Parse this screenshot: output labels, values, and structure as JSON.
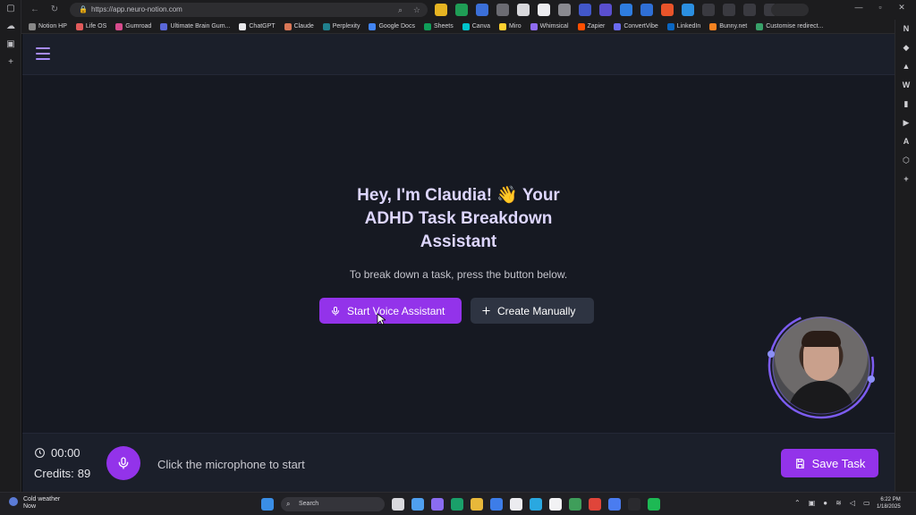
{
  "browser": {
    "url": "https://app.neuro-notion.com",
    "bookmarks": [
      "Notion HP",
      "Life OS",
      "Gumroad",
      "Ultimate Brain Gum...",
      "ChatGPT",
      "Claude",
      "Perplexity",
      "Google Docs",
      "Sheets",
      "Canva",
      "Miro",
      "Whimsical",
      "Zapier",
      "ConvertVibe",
      "LinkedIn",
      "Bunny.net",
      "Customise redirect..."
    ],
    "right_rail": [
      "N",
      "◆",
      "▲",
      "W",
      "▮",
      "▶",
      "A",
      "⬡",
      "+"
    ]
  },
  "hero": {
    "title": "Hey, I'm Claudia! 👋 Your ADHD Task Breakdown Assistant",
    "subtitle": "To break down a task, press the button below."
  },
  "actions": {
    "voice_label": "Start Voice Assistant",
    "manual_label": "Create Manually"
  },
  "footer": {
    "timer": "00:00",
    "credits_label": "Credits:",
    "credits_value": "89",
    "hint": "Click the microphone to start",
    "save_label": "Save Task"
  },
  "taskbar": {
    "weather_title": "Cold weather",
    "weather_sub": "Now",
    "search_placeholder": "Search",
    "time": "6:22 PM",
    "date": "1/18/2025"
  },
  "colors": {
    "accent": "#9333ea",
    "title": "#ddd6fe",
    "background": "#161922"
  }
}
